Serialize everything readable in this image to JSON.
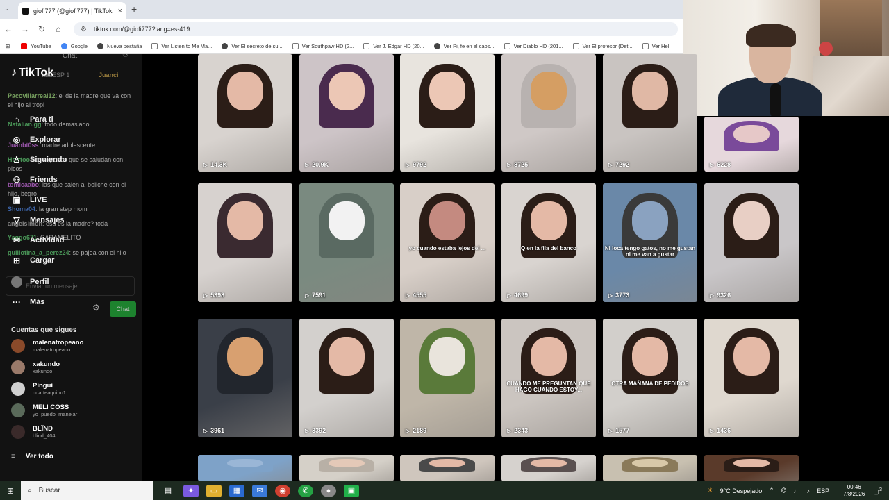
{
  "browser": {
    "tab_title": "giofi777 (@giofi777) | TikTok",
    "tab_close": "×",
    "new_tab": "+",
    "url": "tiktok.com/@giofi777?lang=es-419",
    "bookmarks": [
      {
        "label": "YouTube",
        "icon": "youtube-icon"
      },
      {
        "label": "Google",
        "icon": "google-icon"
      },
      {
        "label": "Nueva pestaña",
        "icon": "newtab-icon"
      },
      {
        "label": "Ver Listen to Me Ma...",
        "icon": "page-icon"
      },
      {
        "label": "Ver El secreto de su...",
        "icon": "globe-icon"
      },
      {
        "label": "Ver Southpaw HD (2...",
        "icon": "page-icon"
      },
      {
        "label": "Ver J. Edgar HD (20...",
        "icon": "page-icon"
      },
      {
        "label": "Ver Pi, fe en el caos...",
        "icon": "globe-icon"
      },
      {
        "label": "Ver Diablo HD (201...",
        "icon": "page-icon"
      },
      {
        "label": "Ver El profesor (Det...",
        "icon": "page-icon"
      },
      {
        "label": "Ver Hel",
        "icon": "page-icon"
      }
    ]
  },
  "chat": {
    "title": "Chat",
    "badge_left": "tataESP 1",
    "badge_right": "Juanci",
    "messages": [
      {
        "user": "Pacovillarreal12",
        "text": ": el de la madre que va con el hijo al tropi",
        "color": "#9ad27a"
      },
      {
        "user": "Natalian.gg",
        "text": ": todo demasiado",
        "color": "#5cc36f"
      },
      {
        "user": "Juanbt0ss",
        "text": ": madre adolescente",
        "color": "#c36ad9"
      },
      {
        "user": "Hoirtoo",
        "text": ": los nigrones que se saludan con picos",
        "color": "#5cc36f"
      },
      {
        "user": "tomicaabo",
        "text": ": las que salen al boliche con el hijo, begro",
        "color": "#c36ad9"
      },
      {
        "user": "Shoma04",
        "text": ": la gran step mom",
        "color": "#4a7fd9"
      },
      {
        "user": "angelsimon",
        "text": ": esa es la madre? toda",
        "color": "#aaaaaa"
      },
      {
        "user": "Yaggo671",
        "text": ": CARAMELITO",
        "color": "#5cc36f"
      },
      {
        "user": "guillotina_a_perez24",
        "text": ": se pajea con el hijo",
        "color": "#5cc36f"
      }
    ],
    "input_placeholder": "Enviar un mensaje",
    "send_label": "Chat"
  },
  "tiktok": {
    "logo": "TikTok",
    "nav": [
      {
        "label": "Para ti",
        "icon": "home-icon",
        "glyph": "⌂"
      },
      {
        "label": "Explorar",
        "icon": "compass-icon",
        "glyph": "◎"
      },
      {
        "label": "Siguiendo",
        "icon": "following-icon",
        "glyph": "♙"
      },
      {
        "label": "Friends",
        "icon": "friends-icon",
        "glyph": "⚇"
      },
      {
        "label": "LIVE",
        "icon": "live-icon",
        "glyph": "▣"
      },
      {
        "label": "Mensajes",
        "icon": "messages-icon",
        "glyph": "▽"
      },
      {
        "label": "Actividad",
        "icon": "activity-icon",
        "glyph": "✉"
      },
      {
        "label": "Cargar",
        "icon": "upload-icon",
        "glyph": "⊞"
      },
      {
        "label": "Perfil",
        "icon": "profile-avatar-icon",
        "glyph": ""
      },
      {
        "label": "Más",
        "icon": "more-icon",
        "glyph": "···"
      }
    ],
    "following_title": "Cuentas que sigues",
    "following": [
      {
        "name": "malenatropeano",
        "handle": "malenatropeano",
        "color": "#8a4a2a"
      },
      {
        "name": "xakundo",
        "handle": "xakundo",
        "color": "#9a7a6a"
      },
      {
        "name": "Pingui",
        "handle": "duarteaquino1",
        "color": "#d0d0d0"
      },
      {
        "name": "MELI COSS",
        "handle": "yo_puedo_manejar",
        "color": "#5a6a5a"
      },
      {
        "name": "BLÏND",
        "handle": "blind_404",
        "color": "#3a2a2a"
      }
    ],
    "see_all": "Ver todo"
  },
  "videos": [
    {
      "views": "14.3K",
      "bg": "#d8d3cf",
      "face": "#e4b9a6",
      "hair": "#2b1d17",
      "caption": ""
    },
    {
      "views": "20.9K",
      "bg": "#cdc4c7",
      "face": "#ecc7b5",
      "hair": "#4a2b4e",
      "caption": ""
    },
    {
      "views": "9792",
      "bg": "#e8e4de",
      "face": "#ecc7b5",
      "hair": "#2b1d17",
      "caption": ""
    },
    {
      "views": "8725",
      "bg": "#cfc8c6",
      "face": "#d59e63",
      "hair": "#b8b2b0",
      "caption": ""
    },
    {
      "views": "7292",
      "bg": "#c9c4c1",
      "face": "#e0b8a5",
      "hair": "#2b1d17",
      "caption": ""
    },
    {
      "views": "6228",
      "bg": "#e6d8dc",
      "face": "#e6c8c8",
      "hair": "#7a4a9a",
      "caption": ""
    },
    {
      "views": "5398",
      "bg": "#d7d2cf",
      "face": "#e4b9a6",
      "hair": "#3a2a30",
      "caption": ""
    },
    {
      "views": "7591",
      "bg": "#7a8a80",
      "face": "#f2f2f2",
      "hair": "#5a6a62",
      "caption": ""
    },
    {
      "views": "4555",
      "bg": "#d8cfc8",
      "face": "#c48a80",
      "hair": "#2b1d17",
      "caption": "yo cuando estaba lejos del ..."
    },
    {
      "views": "4699",
      "bg": "#d9d4d0",
      "face": "#e4b9a6",
      "hair": "#2b1d17",
      "caption": "Q en la fila del banco"
    },
    {
      "views": "3773",
      "bg": "#6a88a8",
      "face": "#8aa2c0",
      "hair": "#3a3a3a",
      "caption": "Ni loca tengo gatos, no me gustan ni me van a gustar"
    },
    {
      "views": "9326",
      "bg": "#c9c6c8",
      "face": "#e8cfc5",
      "hair": "#2b1d17",
      "caption": ""
    },
    {
      "views": "3961",
      "bg": "#3a3f48",
      "face": "#d8a070",
      "hair": "#22262d",
      "caption": ""
    },
    {
      "views": "3392",
      "bg": "#d3d0cd",
      "face": "#e4b9a6",
      "hair": "#2b1d17",
      "caption": ""
    },
    {
      "views": "2189",
      "bg": "#bfb6a8",
      "face": "#e9e4dc",
      "hair": "#5a7a3a",
      "caption": ""
    },
    {
      "views": "2343",
      "bg": "#cbc5c0",
      "face": "#e4b9a6",
      "hair": "#2b1d17",
      "caption": "CUANDO ME PREGUNTAN QUE HAGO CUANDO ESTOY..."
    },
    {
      "views": "1577",
      "bg": "#d2cfcb",
      "face": "#e4b9a6",
      "hair": "#2b1d17",
      "caption": "OTRA MAÑANA DE PEDIDOS"
    },
    {
      "views": "1436",
      "bg": "#dfd8cf",
      "face": "#e4b9a6",
      "hair": "#2b1d17",
      "caption": ""
    },
    {
      "views": "",
      "bg": "#7ea2c8",
      "face": "#9ab6d6",
      "hair": "#7ea2c8",
      "caption": ""
    },
    {
      "views": "",
      "bg": "#d5d0c8",
      "face": "#e4c9b8",
      "hair": "#b8b0a6",
      "caption": ""
    },
    {
      "views": "",
      "bg": "#cfc6bd",
      "face": "#e4b9a6",
      "hair": "#4a4a4a",
      "caption": ""
    },
    {
      "views": "",
      "bg": "#d6d2ce",
      "face": "#e4b9a6",
      "hair": "#5a5050",
      "caption": ""
    },
    {
      "views": "",
      "bg": "#c8c0b0",
      "face": "#d8c8a8",
      "hair": "#8a7a5a",
      "caption": ""
    },
    {
      "views": "",
      "bg": "#5a3a2a",
      "face": "#e4b9a6",
      "hair": "#2b1d17",
      "caption": ""
    }
  ],
  "taskbar": {
    "search_label": "Buscar",
    "weather": "9°C  Despejado",
    "lang": "ESP",
    "time": "00:46",
    "date": "7/8/2026",
    "notif": "3"
  }
}
